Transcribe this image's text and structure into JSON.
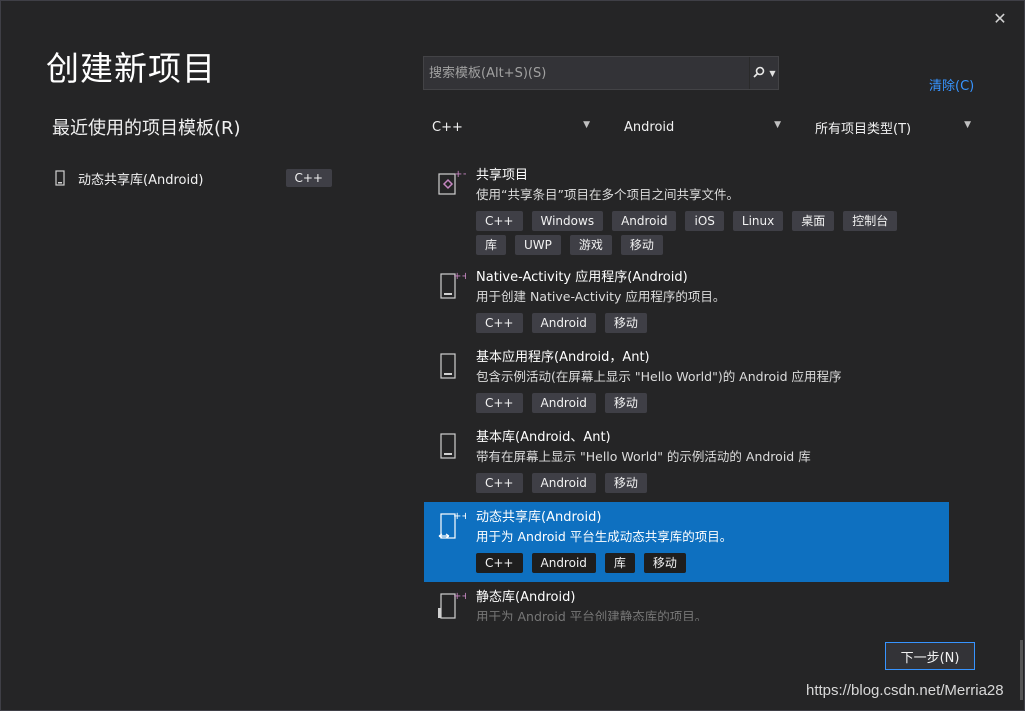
{
  "header": {
    "title": "创建新项目",
    "close_icon": "close-icon"
  },
  "recent": {
    "title": "最近使用的项目模板(R)",
    "items": [
      {
        "label": "动态共享库(Android)",
        "badge": "C++",
        "icon": "phone-icon"
      }
    ]
  },
  "search": {
    "placeholder": "搜索模板(Alt+S)(S)",
    "value": "",
    "icon": "search-icon"
  },
  "clear_label": "清除(C)",
  "filters": {
    "language": "C++",
    "platform": "Android",
    "project_type": "所有项目类型(T)"
  },
  "templates": [
    {
      "name": "共享项目",
      "desc": "使用“共享条目”项目在多个项目之间共享文件。",
      "tags": [
        "C++",
        "Windows",
        "Android",
        "iOS",
        "Linux",
        "桌面",
        "控制台",
        "库",
        "UWP",
        "游戏",
        "移动"
      ],
      "selected": false
    },
    {
      "name": "Native-Activity 应用程序(Android)",
      "desc": "用于创建 Native-Activity 应用程序的项目。",
      "tags": [
        "C++",
        "Android",
        "移动"
      ],
      "selected": false
    },
    {
      "name": "基本应用程序(Android，Ant)",
      "desc": "包含示例活动(在屏幕上显示 \"Hello World\")的 Android 应用程序",
      "tags": [
        "C++",
        "Android",
        "移动"
      ],
      "selected": false
    },
    {
      "name": "基本库(Android、Ant)",
      "desc": "带有在屏幕上显示 \"Hello World\" 的示例活动的 Android 库",
      "tags": [
        "C++",
        "Android",
        "移动"
      ],
      "selected": false
    },
    {
      "name": "动态共享库(Android)",
      "desc": "用于为 Android 平台生成动态共享库的项目。",
      "tags": [
        "C++",
        "Android",
        "库",
        "移动"
      ],
      "selected": true
    },
    {
      "name": "静态库(Android)",
      "desc": "用于为 Android 平台创建静态库的项目。",
      "tags": [],
      "selected": false
    }
  ],
  "next_label": "下一步(N)",
  "watermark": "https://blog.csdn.net/Merria28",
  "colors": {
    "accent": "#0e70c0",
    "link": "#3794ff",
    "background": "#252526"
  }
}
